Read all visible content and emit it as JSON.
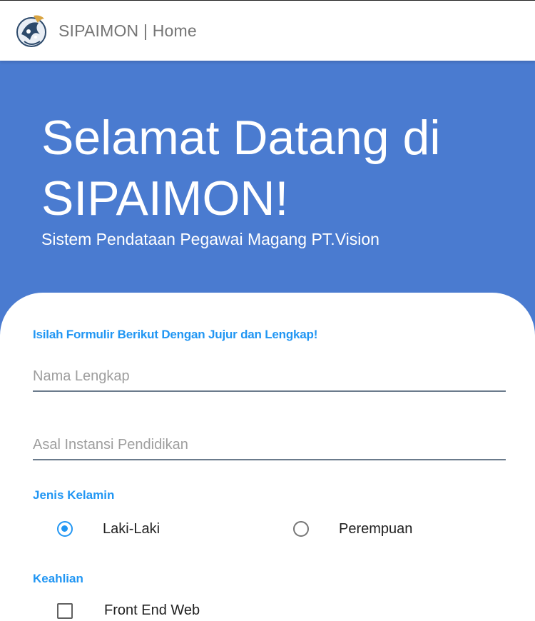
{
  "header": {
    "title": "SIPAIMON | Home",
    "logo_icon": "sipaimon-logo-icon"
  },
  "hero": {
    "title": "Selamat Datang di SIPAIMON!",
    "subtitle": "Sistem Pendataan Pegawai Magang PT.Vision",
    "background_color": "#4a7bd0"
  },
  "form": {
    "caption": "Isilah Formulir Berikut Dengan Jujur dan Lengkap!",
    "nama": {
      "placeholder": "Nama Lengkap",
      "value": ""
    },
    "instansi": {
      "placeholder": "Asal Instansi Pendidikan",
      "value": ""
    },
    "gender": {
      "label": "Jenis Kelamin",
      "options": [
        "Laki-Laki",
        "Perempuan"
      ],
      "selected": "Laki-Laki"
    },
    "skills": {
      "label": "Keahlian",
      "options": [
        "Front End Web"
      ]
    },
    "accent_color": "#2196f3"
  }
}
